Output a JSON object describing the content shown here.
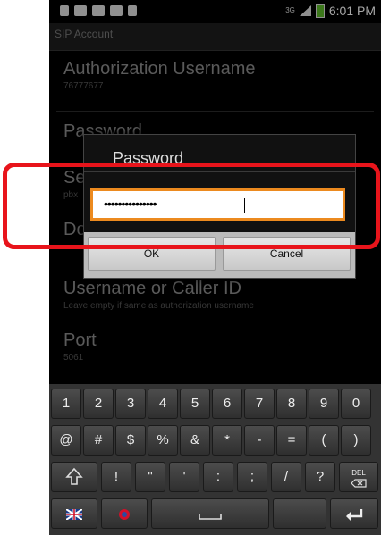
{
  "status_bar": {
    "network_label": "3G",
    "time": "6:01 PM",
    "battery_color": "#5cb82a"
  },
  "titlebar": {
    "title": "SIP Account"
  },
  "settings": [
    {
      "title": "Authorization Username",
      "summary": "76777677"
    },
    {
      "title": "Password",
      "summary": ""
    },
    {
      "title": "Server or Proxy",
      "summary": "pbx"
    },
    {
      "title": "Domain",
      "summary": ""
    },
    {
      "title": "Username or Caller ID",
      "summary": "Leave empty if same as authorization username"
    },
    {
      "title": "Port",
      "summary": "5061"
    }
  ],
  "dialog": {
    "title": "Password",
    "input_value": "•••••••••••••••",
    "ok_label": "OK",
    "cancel_label": "Cancel"
  },
  "keyboard": {
    "row1": [
      "1",
      "2",
      "3",
      "4",
      "5",
      "6",
      "7",
      "8",
      "9",
      "0"
    ],
    "row2": [
      "@",
      "#",
      "$",
      "%",
      "&",
      "*",
      "-",
      "=",
      "(",
      ")"
    ],
    "row3": [
      "!",
      "\"",
      "'",
      ":",
      ";",
      "/",
      "?"
    ],
    "del_label": "DEL",
    "icons": [
      "shift-icon",
      "del-icon",
      "language-flag-icon",
      "record-icon",
      "space-icon",
      "enter-icon"
    ]
  },
  "colors": {
    "focus_border": "#ec8a1f",
    "highlight_box": "#e8141b"
  }
}
